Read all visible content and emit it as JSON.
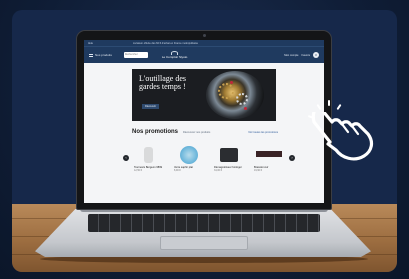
{
  "site": {
    "topbar_left": "Aide",
    "topbar_promo": "Livraison offerte dès 60 € d'achat en France métropolitaine",
    "menu_label": "Nos produits",
    "search_placeholder": "Rechercher",
    "logo_text": "Le Comptoir Siyuto",
    "nav_account": "Mon compte",
    "nav_favorites": "Favoris",
    "cart_count": "0"
  },
  "hero": {
    "title": "L'outillage des gardes temps !",
    "button_label": "Découvrir"
  },
  "promotions": {
    "title": "Nos promotions",
    "subtitle": "Découvrez nos produits",
    "link": "Voir toutes les promotions",
    "products": [
      {
        "name": "Tournevis Bergeon 6899",
        "price": "12,50 €",
        "image": "screwdriver-icon"
      },
      {
        "name": "Verre saphir plat",
        "price": "8,90 €",
        "image": "sapphire-glass-icon"
      },
      {
        "name": "Démagnétiseur horloger",
        "price": "34,00 €",
        "image": "demagnetizer-icon"
      },
      {
        "name": "Bracelet cuir",
        "price": "19,90 €",
        "image": "strap-icon"
      }
    ]
  },
  "colors": {
    "navy": "#1f3a5f",
    "background": "#16284a",
    "wood": "#9c6d40"
  }
}
